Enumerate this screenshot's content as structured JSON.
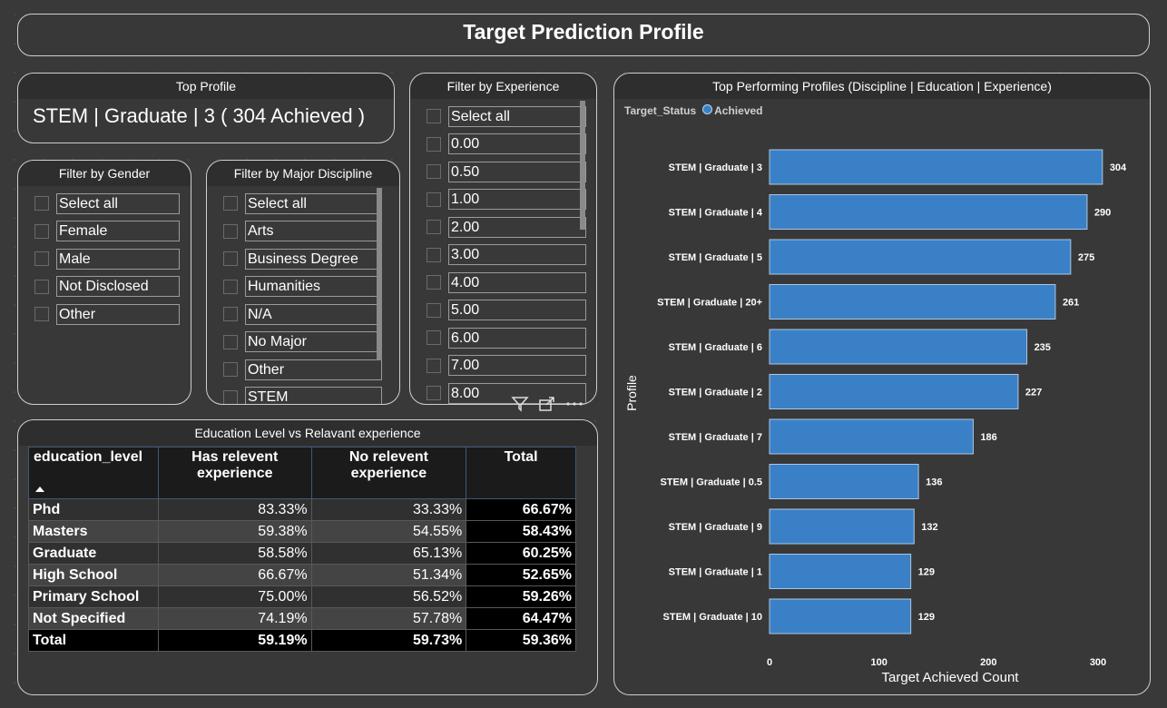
{
  "header": {
    "title": "Target Prediction Profile"
  },
  "top_profile": {
    "heading": "Top Profile",
    "value": "STEM | Graduate | 3 ( 304 Achieved )"
  },
  "gender_filter": {
    "heading": "Filter by Gender",
    "items": [
      "Select all",
      "Female",
      "Male",
      "Not Disclosed",
      "Other"
    ]
  },
  "major_filter": {
    "heading": "Filter by Major Discipline",
    "items": [
      "Select all",
      "Arts",
      "Business Degree",
      "Humanities",
      "N/A",
      "No Major",
      "Other",
      "STEM"
    ]
  },
  "experience_filter": {
    "heading": "Filter by Experience",
    "items": [
      "Select all",
      "0.00",
      "0.50",
      "1.00",
      "2.00",
      "3.00",
      "4.00",
      "5.00",
      "6.00",
      "7.00",
      "8.00"
    ]
  },
  "table": {
    "heading": "Education Level vs Relavant experience",
    "columns": [
      "education_level",
      "Has relevent experience",
      "No relevent experience",
      "Total"
    ],
    "rows": [
      [
        "Phd",
        "83.33%",
        "33.33%",
        "66.67%"
      ],
      [
        "Masters",
        "59.38%",
        "54.55%",
        "58.43%"
      ],
      [
        "Graduate",
        "58.58%",
        "65.13%",
        "60.25%"
      ],
      [
        "High School",
        "66.67%",
        "51.34%",
        "52.65%"
      ],
      [
        "Primary School",
        "75.00%",
        "56.52%",
        "59.26%"
      ],
      [
        "Not Specified",
        "74.19%",
        "57.78%",
        "64.47%"
      ]
    ],
    "total_row": [
      "Total",
      "59.19%",
      "59.73%",
      "59.36%"
    ]
  },
  "chart_data": {
    "type": "bar",
    "orientation": "horizontal",
    "title": "Top Performing Profiles (Discipline | Education | Experience)",
    "legend_title": "Target_Status",
    "legend": [
      "Achieved"
    ],
    "series_color": "#3a80c6",
    "categories": [
      "STEM | Graduate | 3",
      "STEM | Graduate | 4",
      "STEM | Graduate | 5",
      "STEM | Graduate | 20+",
      "STEM | Graduate | 6",
      "STEM | Graduate | 2",
      "STEM | Graduate | 7",
      "STEM | Graduate | 0.5",
      "STEM | Graduate | 9",
      "STEM | Graduate | 1",
      "STEM | Graduate | 10"
    ],
    "values": [
      304,
      290,
      275,
      261,
      235,
      227,
      186,
      136,
      132,
      129,
      129
    ],
    "xlabel": "Target Achieved Count",
    "ylabel": "Profile",
    "xticks": [
      0,
      100,
      200,
      300
    ],
    "xlim": [
      0,
      320
    ]
  }
}
